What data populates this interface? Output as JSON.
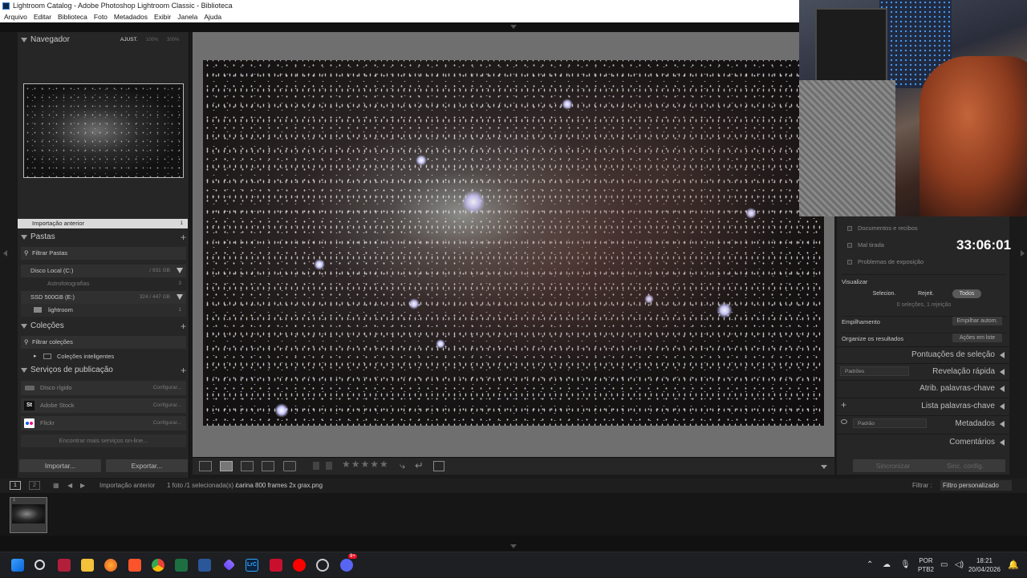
{
  "window": {
    "title": "Lightroom Catalog - Adobe Photoshop Lightroom Classic - Biblioteca"
  },
  "menubar": [
    "Arquivo",
    "Editar",
    "Biblioteca",
    "Foto",
    "Metadados",
    "Exibir",
    "Janela",
    "Ajuda"
  ],
  "navigator": {
    "title": "Navegador",
    "zoom_options": [
      "AJUST.",
      "100%",
      "300%"
    ]
  },
  "catalog": {
    "previous_import": "Importação anterior",
    "count": "1"
  },
  "folders": {
    "title": "Pastas",
    "filter": "Filtrar Pastas",
    "volumes": [
      {
        "name": "Disco Local (C:)",
        "size": "/ 931 GB",
        "children": [
          {
            "name": "Astrofotografias",
            "count": "3"
          }
        ]
      },
      {
        "name": "SSD 500GB (E:)",
        "size": "324 / 447 GB",
        "children": [
          {
            "name": "lightroom",
            "count": "1"
          }
        ]
      }
    ]
  },
  "collections": {
    "title": "Coleções",
    "filter": "Filtrar coleções",
    "smart": "Coleções inteligentes"
  },
  "publish": {
    "title": "Serviços de publicação",
    "services": [
      {
        "name": "Disco rígido",
        "action": "Configurar..."
      },
      {
        "name": "Adobe Stock",
        "action": "Configurar..."
      },
      {
        "name": "Flickr",
        "action": "Configurar..."
      }
    ],
    "find_more": "Encontrar mais serviços on-line..."
  },
  "left_buttons": {
    "import": "Importar...",
    "export": "Exportar..."
  },
  "toolbar": {
    "stars": "★★★★★"
  },
  "right_panel": {
    "checklist": [
      "Documentos e recibos",
      "Mal tirada",
      "Problemas de exposição"
    ],
    "visualizar": {
      "label": "Visualizar",
      "options": [
        "Selecion.",
        "Rejeit.",
        "Todos"
      ],
      "status": "0 seleções, 1 rejeição"
    },
    "stacking": {
      "label": "Empilhamento",
      "button": "Empilhar autom."
    },
    "organize": {
      "label": "Organize os resultados",
      "button": "Ações em lote"
    },
    "sections": [
      "Pontuações de seleção",
      "Revelação rápida",
      "Atrib. palavras-chave",
      "Lista palavras-chave",
      "Metadados",
      "Comentários"
    ],
    "quick_develop_preset": "Padrões",
    "metadata_preset": "Padrão",
    "sync": "Sincronizar",
    "sync_settings": "Sinc. config."
  },
  "timer": "33:06:01",
  "filmstrip": {
    "monitors": [
      "1",
      "2"
    ],
    "source": "Importação anterior",
    "info": "1 foto /1 selecionada(s) /",
    "filename": "carina 800 frames 2x grax.png",
    "filter_label": "Filtrar :",
    "filter_value": "Filtro personalizado",
    "thumb_index": "1"
  },
  "taskbar": {
    "tray_lang": "POR",
    "tray_layout": "PTB2",
    "time": "18:21",
    "date": "20/04/2026",
    "apps": [
      "windows-start",
      "search",
      "app-red",
      "file-explorer",
      "firefox",
      "brave",
      "chrome",
      "excel",
      "word",
      "proton-vpn",
      "lightroom",
      "news",
      "youtube",
      "app-circle",
      "discord"
    ],
    "discord_badge": "9+"
  },
  "colors": {
    "accent": "#c9c9c9",
    "panel": "#262626",
    "background": "#1a1a1a"
  }
}
